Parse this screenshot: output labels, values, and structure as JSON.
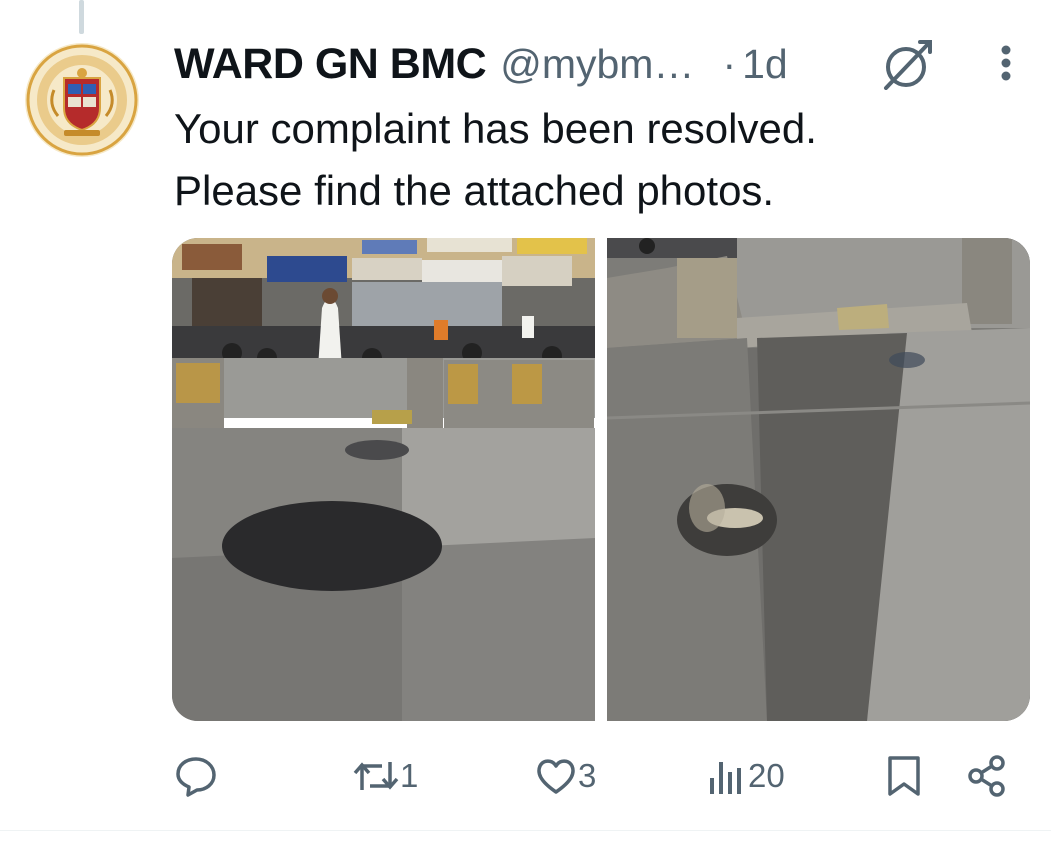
{
  "account": {
    "display_name": "WARD GN BMC",
    "handle": "@mybm…",
    "separator": "·",
    "timestamp": "1d",
    "avatar_icon": "bmc-emblem-icon"
  },
  "tweet": {
    "line1": "Your complaint has been resolved.",
    "line2": "Please find the attached photos."
  },
  "media": [
    {
      "name": "photo-before-after-left",
      "alt": ""
    },
    {
      "name": "photo-pothole-right",
      "alt": ""
    }
  ],
  "actions": {
    "reply_count": "",
    "repost_count": "1",
    "like_count": "3",
    "views_count": "20"
  },
  "colors": {
    "text_primary": "#0f1419",
    "text_secondary": "#536471",
    "avatar_ring": "#d9a441",
    "avatar_shield": "#b52b2b"
  }
}
